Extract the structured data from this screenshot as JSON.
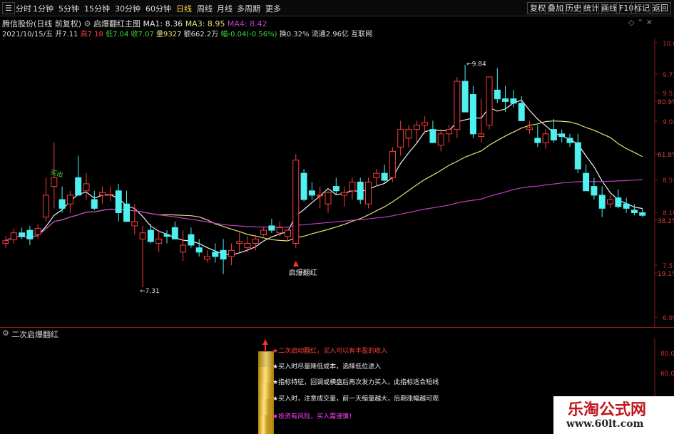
{
  "toolbar": {
    "periods": [
      "分时",
      "1分钟",
      "5分钟",
      "15分钟",
      "30分钟",
      "60分钟",
      "日线",
      "周线",
      "月线",
      "多周期",
      "更多"
    ],
    "right_buttons": [
      "复权",
      "叠加",
      "历史",
      "统计",
      "画线",
      "F10",
      "标记",
      "返回"
    ]
  },
  "header": {
    "title": "腾信股份(日线 前复权)",
    "formula": "启爆翻红主图",
    "ma1": "MA1: 8.36",
    "ma3": "MA3: 8.95",
    "ma4": "MA4: 8.42",
    "date_open": "2021/10/15/五 开7.11",
    "high": "高7.18",
    "low": "低7.04",
    "close": "收7.07",
    "volume": "量9327",
    "amount": "额662.2万",
    "change": "幅-0.04(-0.56%)",
    "turnover": "换0.32%",
    "float": "流通2.96亿",
    "sector": "互联网"
  },
  "sub_panel": {
    "title": "二次启爆翻红",
    "notes": [
      "★二次启动翻红，买入可以有丰盈的收入",
      "★买入时尽量降低成本，选择低位进入",
      "★指标特征，回调或横盘后再次发力买入，此指标适合短线",
      "★买入时，注意成交量，前一天缩量越大，后期涨幅越可观",
      "★投资有风险，买入需谨慎！"
    ]
  },
  "watermark": {
    "line1": "乐淘公式网",
    "line2": "www.60lt.com"
  },
  "chart_data": {
    "type": "candlestick",
    "price_axis_ticks": [
      "10.09",
      "9.71",
      "9.51",
      "80.9%",
      "9.03",
      "61.8%",
      "8.57",
      "8.10",
      "38.2%",
      "7.57",
      "19.1%",
      "6.95"
    ],
    "sub_axis_ticks": [
      "80.00",
      "60.00"
    ],
    "annotations": {
      "high_label": "9.84",
      "low_label": "7.31",
      "signal_label": "启爆翻红",
      "buy_label": "买出"
    },
    "ohlc": [
      [
        7.8,
        7.88,
        7.75,
        7.83
      ],
      [
        7.84,
        7.97,
        7.8,
        7.92
      ],
      [
        7.92,
        7.98,
        7.85,
        7.88
      ],
      [
        7.95,
        8.0,
        7.78,
        7.85
      ],
      [
        7.9,
        8.02,
        7.85,
        7.97
      ],
      [
        8.1,
        8.55,
        8.05,
        8.35
      ],
      [
        8.45,
        8.95,
        8.2,
        8.55
      ],
      [
        8.3,
        8.45,
        8.15,
        8.2
      ],
      [
        8.25,
        8.4,
        8.15,
        8.35
      ],
      [
        8.55,
        8.8,
        8.45,
        8.35
      ],
      [
        8.4,
        8.6,
        8.3,
        8.48
      ],
      [
        8.3,
        8.4,
        8.18,
        8.2
      ],
      [
        8.35,
        8.45,
        8.25,
        8.38
      ],
      [
        8.35,
        8.45,
        8.28,
        8.36
      ],
      [
        8.4,
        8.48,
        8.05,
        8.15
      ],
      [
        8.25,
        8.4,
        8.1,
        8.05
      ],
      [
        8.0,
        8.25,
        7.9,
        8.05
      ],
      [
        7.85,
        8.0,
        7.3,
        7.92
      ],
      [
        7.95,
        8.02,
        7.8,
        7.82
      ],
      [
        7.8,
        7.95,
        7.7,
        7.85
      ],
      [
        7.9,
        7.95,
        7.8,
        7.88
      ],
      [
        7.98,
        8.05,
        7.9,
        7.85
      ],
      [
        7.7,
        7.95,
        7.6,
        7.78
      ],
      [
        7.9,
        7.98,
        7.75,
        7.78
      ],
      [
        7.75,
        7.85,
        7.65,
        7.7
      ],
      [
        7.62,
        7.72,
        7.58,
        7.65
      ],
      [
        7.7,
        7.8,
        7.58,
        7.65
      ],
      [
        7.72,
        7.85,
        7.45,
        7.62
      ],
      [
        7.65,
        7.8,
        7.55,
        7.72
      ],
      [
        7.8,
        7.92,
        7.7,
        7.82
      ],
      [
        7.75,
        7.88,
        7.7,
        7.8
      ],
      [
        7.8,
        7.9,
        7.72,
        7.85
      ],
      [
        7.9,
        7.98,
        7.88,
        7.95
      ],
      [
        8.0,
        8.08,
        7.92,
        7.95
      ],
      [
        7.92,
        8.05,
        7.88,
        7.98
      ],
      [
        7.88,
        7.95,
        7.83,
        7.95
      ],
      [
        7.8,
        8.82,
        7.75,
        8.75
      ],
      [
        8.6,
        8.65,
        8.28,
        8.3
      ],
      [
        8.4,
        8.5,
        8.3,
        8.35
      ],
      [
        8.35,
        8.45,
        8.2,
        8.35
      ],
      [
        8.25,
        8.4,
        8.15,
        8.38
      ],
      [
        8.45,
        8.55,
        8.35,
        8.4
      ],
      [
        8.35,
        8.45,
        8.22,
        8.38
      ],
      [
        8.4,
        8.55,
        8.3,
        8.5
      ],
      [
        8.5,
        8.55,
        8.25,
        8.3
      ],
      [
        8.25,
        8.55,
        8.2,
        8.5
      ],
      [
        8.55,
        8.65,
        8.45,
        8.6
      ],
      [
        8.6,
        8.7,
        8.5,
        8.52
      ],
      [
        8.55,
        8.9,
        8.5,
        8.85
      ],
      [
        8.9,
        9.2,
        8.8,
        9.1
      ],
      [
        9.0,
        9.15,
        8.9,
        9.1
      ],
      [
        9.1,
        9.2,
        8.95,
        9.15
      ],
      [
        9.15,
        9.25,
        9.05,
        9.18
      ],
      [
        9.1,
        9.2,
        8.95,
        8.95
      ],
      [
        8.92,
        9.1,
        8.85,
        9.05
      ],
      [
        9.05,
        9.15,
        8.95,
        9.1
      ],
      [
        9.1,
        9.7,
        9.0,
        9.65
      ],
      [
        9.65,
        9.84,
        9.4,
        9.3
      ],
      [
        9.5,
        9.6,
        9.0,
        9.05
      ],
      [
        9.02,
        9.45,
        8.95,
        9.05
      ],
      [
        9.15,
        9.7,
        9.1,
        9.7
      ],
      [
        9.55,
        9.8,
        9.4,
        9.45
      ],
      [
        9.45,
        9.6,
        9.3,
        9.42
      ],
      [
        9.45,
        9.55,
        9.35,
        9.4
      ],
      [
        9.4,
        9.48,
        9.2,
        9.2
      ],
      [
        9.1,
        9.2,
        9.05,
        9.12
      ],
      [
        9.0,
        9.15,
        8.9,
        8.95
      ],
      [
        8.95,
        9.1,
        8.88,
        9.05
      ],
      [
        9.1,
        9.22,
        8.95,
        8.98
      ],
      [
        9.05,
        9.1,
        8.95,
        9.02
      ],
      [
        9.0,
        9.05,
        8.9,
        8.95
      ],
      [
        8.95,
        9.05,
        8.6,
        8.65
      ],
      [
        8.6,
        8.7,
        8.4,
        8.4
      ],
      [
        8.45,
        8.55,
        8.3,
        8.35
      ],
      [
        8.35,
        8.45,
        8.1,
        8.2
      ],
      [
        8.25,
        8.35,
        8.2,
        8.3
      ],
      [
        8.32,
        8.42,
        8.2,
        8.22
      ],
      [
        8.25,
        8.32,
        8.15,
        8.2
      ],
      [
        8.18,
        8.25,
        8.12,
        8.15
      ],
      [
        8.15,
        8.2,
        8.1,
        8.12
      ]
    ],
    "series": [
      {
        "name": "MA1",
        "color": "#f0f0f0"
      },
      {
        "name": "MA3",
        "color": "#e6e07a"
      },
      {
        "name": "MA4",
        "color": "#c040c0"
      }
    ]
  }
}
